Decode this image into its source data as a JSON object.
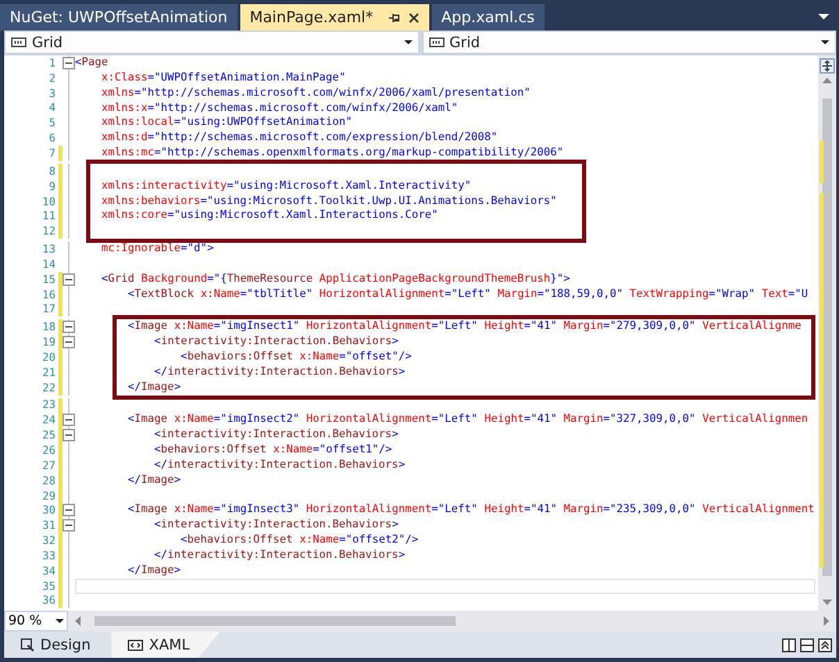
{
  "tabs": [
    {
      "label": "NuGet: UWPOffsetAnimation",
      "selected": false
    },
    {
      "label": "MainPage.xaml*",
      "selected": true
    },
    {
      "label": "App.xaml.cs",
      "selected": false
    }
  ],
  "navigation": [
    {
      "label": "Grid"
    },
    {
      "label": "Grid"
    }
  ],
  "editor": {
    "blocks": [
      {
        "boxed": false,
        "lines": [
          {
            "number": "1",
            "text": "<Page",
            "modified": false,
            "fold": true,
            "current": false
          },
          {
            "number": "2",
            "text": "    x:Class=\"UWPOffsetAnimation.MainPage\"",
            "modified": false,
            "fold": false,
            "current": false
          },
          {
            "number": "3",
            "text": "    xmlns=\"http://schemas.microsoft.com/winfx/2006/xaml/presentation\"",
            "modified": false,
            "fold": false,
            "current": false
          },
          {
            "number": "4",
            "text": "    xmlns:x=\"http://schemas.microsoft.com/winfx/2006/xaml\"",
            "modified": false,
            "fold": false,
            "current": false
          },
          {
            "number": "5",
            "text": "    xmlns:local=\"using:UWPOffsetAnimation\"",
            "modified": false,
            "fold": false,
            "current": false
          },
          {
            "number": "6",
            "text": "    xmlns:d=\"http://schemas.microsoft.com/expression/blend/2008\"",
            "modified": false,
            "fold": false,
            "current": false
          },
          {
            "number": "7",
            "text": "    xmlns:mc=\"http://schemas.openxmlformats.org/markup-compatibility/2006\"",
            "modified": true,
            "fold": false,
            "current": false
          }
        ]
      },
      {
        "boxed": true,
        "lines": [
          {
            "number": "8",
            "modified": true,
            "fold": false,
            "current": false
          },
          {
            "number": "9",
            "text": "    xmlns:interactivity=\"using:Microsoft.Xaml.Interactivity\"",
            "modified": true,
            "fold": false,
            "current": false
          },
          {
            "number": "10",
            "text": "    xmlns:behaviors=\"using:Microsoft.Toolkit.Uwp.UI.Animations.Behaviors\"",
            "modified": true,
            "fold": false,
            "current": false
          },
          {
            "number": "11",
            "text": "    xmlns:core=\"using:Microsoft.Xaml.Interactions.Core\"",
            "modified": true,
            "fold": false,
            "current": false
          },
          {
            "number": "12",
            "modified": true,
            "fold": false,
            "current": false
          }
        ]
      },
      {
        "boxed": false,
        "lines": [
          {
            "number": "13",
            "text": "    mc:Ignorable=\"d\">",
            "modified": false,
            "fold": false,
            "current": false
          },
          {
            "number": "14",
            "modified": false,
            "fold": false,
            "current": false
          },
          {
            "number": "15",
            "text": "    <Grid Background=\"{ThemeResource ApplicationPageBackgroundThemeBrush}\">",
            "modified": true,
            "fold": true,
            "current": false
          },
          {
            "number": "16",
            "text": "        <TextBlock x:Name=\"tblTitle\" HorizontalAlignment=\"Left\" Margin=\"188,59,0,0\" TextWrapping=\"Wrap\" Text=\"U",
            "modified": true,
            "fold": false,
            "current": false
          },
          {
            "number": "17",
            "modified": true,
            "fold": false,
            "current": false
          }
        ]
      },
      {
        "boxed": true,
        "lines": [
          {
            "number": "18",
            "text": "        <Image x:Name=\"imgInsect1\" HorizontalAlignment=\"Left\" Height=\"41\" Margin=\"279,309,0,0\" VerticalAlignme",
            "modified": true,
            "fold": true,
            "current": false
          },
          {
            "number": "19",
            "text": "            <interactivity:Interaction.Behaviors>",
            "modified": true,
            "fold": true,
            "current": false
          },
          {
            "number": "20",
            "text": "                <behaviors:Offset x:Name=\"offset\"/>",
            "modified": true,
            "fold": false,
            "current": false
          },
          {
            "number": "21",
            "text": "            </interactivity:Interaction.Behaviors>",
            "modified": true,
            "fold": false,
            "current": false
          },
          {
            "number": "22",
            "text": "        </Image>",
            "modified": true,
            "fold": false,
            "current": false
          }
        ]
      },
      {
        "boxed": false,
        "lines": [
          {
            "number": "23",
            "modified": true,
            "fold": false,
            "current": false
          },
          {
            "number": "24",
            "text": "        <Image x:Name=\"imgInsect2\" HorizontalAlignment=\"Left\" Height=\"41\" Margin=\"327,309,0,0\" VerticalAlignmen",
            "modified": true,
            "fold": true,
            "current": false
          },
          {
            "number": "25",
            "text": "            <interactivity:Interaction.Behaviors>",
            "modified": true,
            "fold": true,
            "current": false
          },
          {
            "number": "26",
            "text": "            <behaviors:Offset x:Name=\"offset1\"/>",
            "modified": true,
            "fold": false,
            "current": false
          },
          {
            "number": "27",
            "text": "            </interactivity:Interaction.Behaviors>",
            "modified": true,
            "fold": false,
            "current": false
          },
          {
            "number": "28",
            "text": "        </Image>",
            "modified": true,
            "fold": false,
            "current": false
          },
          {
            "number": "29",
            "modified": true,
            "fold": false,
            "current": false
          },
          {
            "number": "30",
            "text": "        <Image x:Name=\"imgInsect3\" HorizontalAlignment=\"Left\" Height=\"41\" Margin=\"235,309,0,0\" VerticalAlignment",
            "modified": true,
            "fold": true,
            "current": false
          },
          {
            "number": "31",
            "text": "            <interactivity:Interaction.Behaviors>",
            "modified": true,
            "fold": true,
            "current": false
          },
          {
            "number": "32",
            "text": "                <behaviors:Offset x:Name=\"offset2\"/>",
            "modified": true,
            "fold": false,
            "current": false
          },
          {
            "number": "33",
            "text": "            </interactivity:Interaction.Behaviors>",
            "modified": true,
            "fold": false,
            "current": false
          },
          {
            "number": "34",
            "text": "        </Image>",
            "modified": true,
            "fold": false,
            "current": false
          },
          {
            "number": "35",
            "modified": true,
            "fold": false,
            "current": true
          },
          {
            "number": "36",
            "modified": true,
            "fold": false,
            "current": false
          }
        ]
      }
    ]
  },
  "zoom": "90 %",
  "view_tabs": [
    {
      "label": "Design",
      "selected": false
    },
    {
      "label": "XAML",
      "selected": true
    }
  ]
}
